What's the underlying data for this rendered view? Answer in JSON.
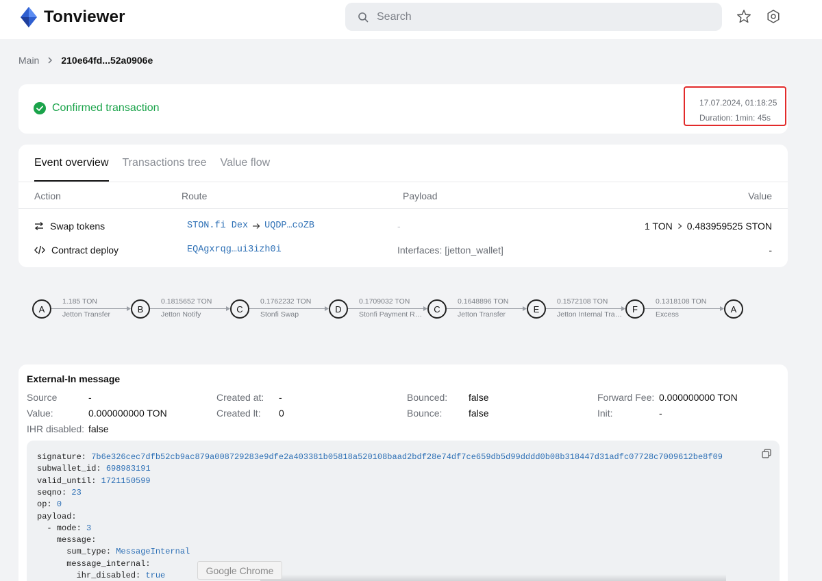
{
  "app": {
    "name": "Tonviewer"
  },
  "search": {
    "placeholder": "Search"
  },
  "breadcrumb": {
    "root": "Main",
    "current": "210e64fd...52a0906e"
  },
  "status": {
    "label": "Confirmed transaction",
    "datetime": "17.07.2024, 01:18:25",
    "duration": "Duration: 1min: 45s"
  },
  "tabs": [
    "Event overview",
    "Transactions tree",
    "Value flow"
  ],
  "actions_table": {
    "headers": {
      "action": "Action",
      "route": "Route",
      "payload": "Payload",
      "value": "Value"
    },
    "rows": [
      {
        "action": "Swap tokens",
        "route_from": "STON.fi Dex",
        "route_to": "UQDP…coZB",
        "payload": "-",
        "value_in": "1 TON",
        "value_out": "0.483959525 STON"
      },
      {
        "action": "Contract deploy",
        "route_from": "EQAgxrqg…ui3izh0i",
        "payload": "Interfaces: [jetton_wallet]",
        "value": "-"
      }
    ]
  },
  "flow": {
    "nodes": [
      "A",
      "B",
      "C",
      "D",
      "C",
      "E",
      "F",
      "A"
    ],
    "edges": [
      {
        "amount": "1.185 TON",
        "label": "Jetton Transfer"
      },
      {
        "amount": "0.1815652 TON",
        "label": "Jetton Notify"
      },
      {
        "amount": "0.1762232 TON",
        "label": "Stonfi Swap"
      },
      {
        "amount": "0.1709032 TON",
        "label": "Stonfi Payment Request"
      },
      {
        "amount": "0.1648896 TON",
        "label": "Jetton Transfer"
      },
      {
        "amount": "0.1572108 TON",
        "label": "Jetton Internal Transfer"
      },
      {
        "amount": "0.1318108 TON",
        "label": "Excess"
      }
    ]
  },
  "message": {
    "title": "External-In message",
    "fields": {
      "source_label": "Source",
      "source": "-",
      "value_label": "Value:",
      "value": "0.000000000 TON",
      "ihr_label": "IHR disabled:",
      "ihr": "false",
      "created_at_label": "Created at:",
      "created_at": "-",
      "created_lt_label": "Created lt:",
      "created_lt": "0",
      "bounced_label": "Bounced:",
      "bounced": "false",
      "bounce_label": "Bounce:",
      "bounce": "false",
      "fwd_fee_label": "Forward Fee:",
      "fwd_fee": "0.000000000 TON",
      "init_label": "Init:",
      "init": "-"
    },
    "code": [
      {
        "key": "signature: ",
        "val": "7b6e326cec7dfb52cb9ac879a008729283e9dfe2a403381b05818a520108baad2bdf28e74df7ce659db5d99dddd0b08b318447d31adfc07728c7009612be8f09"
      },
      {
        "key": "subwallet_id: ",
        "val": "698983191"
      },
      {
        "key": "valid_until: ",
        "val": "1721150599"
      },
      {
        "key": "seqno: ",
        "val": "23"
      },
      {
        "key": "op: ",
        "val": "0"
      },
      {
        "key": "payload:",
        "val": ""
      },
      {
        "key": "  - mode: ",
        "val": "3"
      },
      {
        "key": "    message:",
        "val": ""
      },
      {
        "key": "      sum_type: ",
        "val": "MessageInternal"
      },
      {
        "key": "      message_internal:",
        "val": ""
      },
      {
        "key": "        ihr_disabled: ",
        "val": "true"
      }
    ]
  },
  "overlay": {
    "tooltip": "Google Chrome"
  },
  "colors": {
    "accent_link": "#2c6fb5",
    "success": "#1aa34a",
    "highlight_border": "#e22a2a"
  }
}
